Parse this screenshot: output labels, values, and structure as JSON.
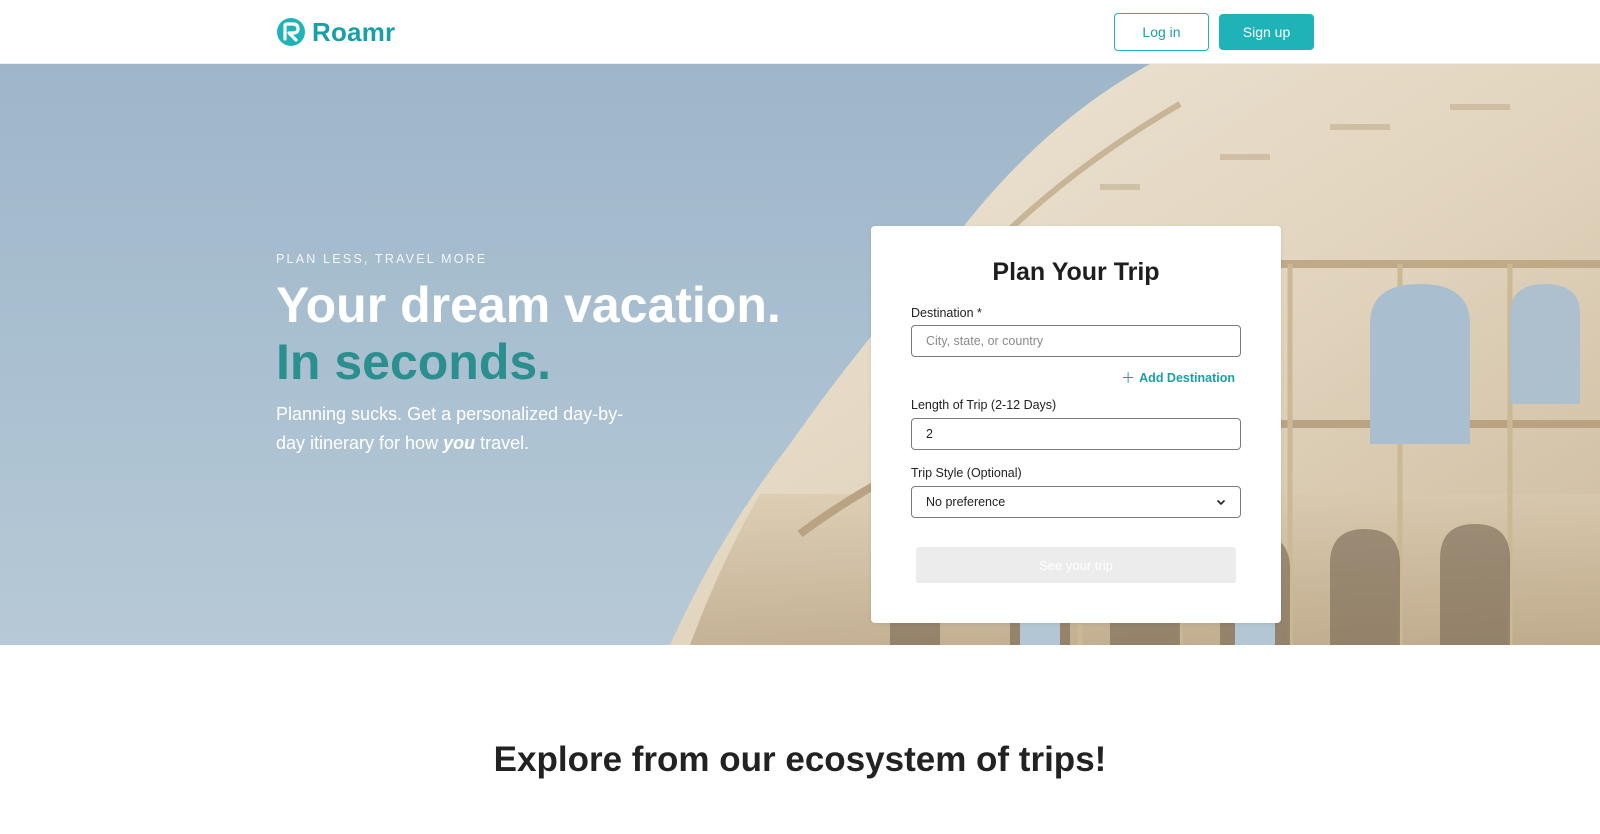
{
  "header": {
    "logo_text": "Roamr",
    "login_label": "Log in",
    "signup_label": "Sign up"
  },
  "hero": {
    "eyebrow": "PLAN LESS, TRAVEL MORE",
    "headline_line1": "Your dream vacation.",
    "headline_line2": "In seconds.",
    "subtext_before": "Planning sucks. Get a personalized day-by-day itinerary for how ",
    "subtext_emphasis": "you",
    "subtext_after": " travel."
  },
  "trip_form": {
    "title": "Plan Your Trip",
    "destination_label": "Destination *",
    "destination_placeholder": "City, state, or country",
    "destination_value": "",
    "add_destination_label": "Add Destination",
    "length_label": "Length of Trip (2-12 Days)",
    "length_value": "2",
    "style_label": "Trip Style (Optional)",
    "style_selected": "No preference",
    "submit_label": "See your trip"
  },
  "explore": {
    "heading": "Explore from our ecosystem of trips!"
  },
  "colors": {
    "brand_teal": "#1fb3b8",
    "headline_accent": "#2b8f8f",
    "sky": "#a8bfd0"
  }
}
